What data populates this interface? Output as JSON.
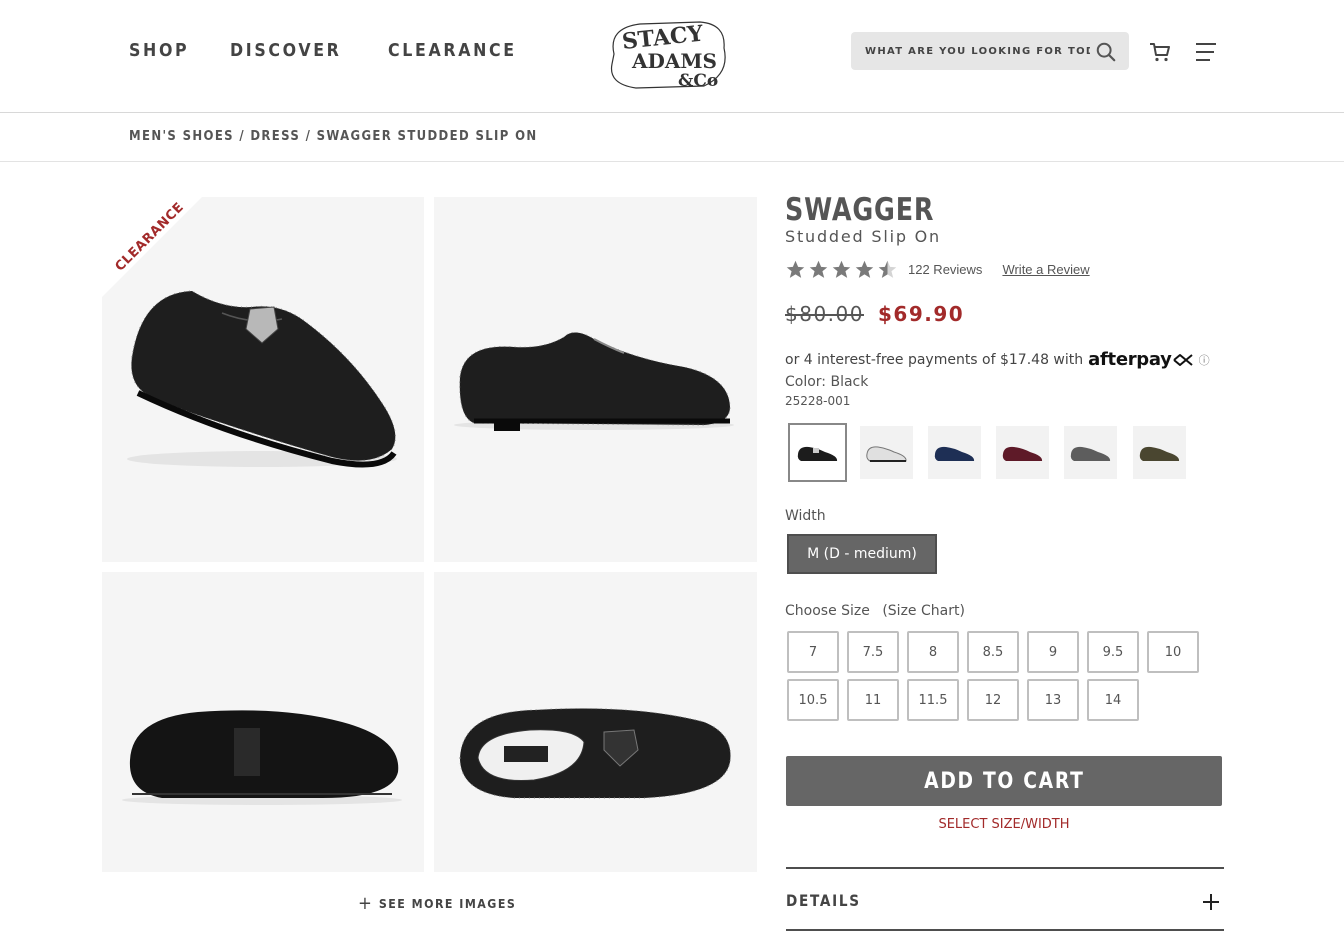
{
  "header": {
    "nav": [
      {
        "label": "SHOP"
      },
      {
        "label": "DISCOVER"
      },
      {
        "label": "CLEARANCE"
      }
    ],
    "logo": {
      "line1": "STACY",
      "line2": "ADAMS",
      "line3": "&Co"
    },
    "search": {
      "placeholder": "WHAT ARE YOU LOOKING FOR TODAY?"
    }
  },
  "breadcrumb": {
    "items": [
      "MEN'S SHOES",
      "DRESS",
      "SWAGGER STUDDED SLIP ON"
    ],
    "separator": "/"
  },
  "gallery": {
    "ribbon_label": "CLEARANCE",
    "see_more_label": "SEE MORE IMAGES"
  },
  "product": {
    "title": "SWAGGER",
    "subtitle": "Studded Slip On",
    "rating": 4.5,
    "reviews_label": "122 Reviews",
    "write_review_label": "Write a Review",
    "old_price": "$80.00",
    "new_price": "$69.90",
    "afterpay_text": "or 4 interest-free payments of $17.48 with",
    "afterpay_brand": "afterpay",
    "afterpay_info": "ⓘ",
    "color_line": "Color: Black",
    "sku": "25228-001",
    "swatches": [
      {
        "name": "Black",
        "color": "#1c1c1c",
        "selected": true
      },
      {
        "name": "White",
        "color": "#e0e0e0",
        "selected": false
      },
      {
        "name": "Navy",
        "color": "#1e2f55",
        "selected": false
      },
      {
        "name": "Burgundy",
        "color": "#5e1a28",
        "selected": false
      },
      {
        "name": "Gray",
        "color": "#5d5d5d",
        "selected": false
      },
      {
        "name": "Olive",
        "color": "#4a4630",
        "selected": false
      }
    ],
    "width_label": "Width",
    "width_option": "M (D - medium)",
    "size_label": "Choose Size",
    "size_chart_label": "(Size Chart)",
    "sizes": [
      "7",
      "7.5",
      "8",
      "8.5",
      "9",
      "9.5",
      "10",
      "10.5",
      "11",
      "11.5",
      "12",
      "13",
      "14"
    ],
    "add_to_cart_label": "ADD TO CART",
    "select_message": "SELECT SIZE/WIDTH",
    "details_label": "DETAILS"
  },
  "colors": {
    "accent_red": "#a22a2a",
    "button_gray": "#666666",
    "text_gray": "#555555"
  }
}
